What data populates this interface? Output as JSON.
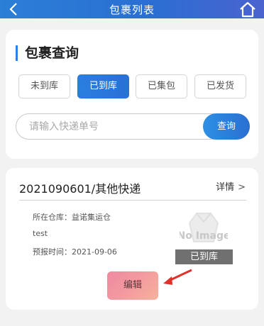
{
  "header": {
    "title": "包裹列表",
    "back_icon": "chevron-left-icon",
    "home_icon": "home-icon"
  },
  "query": {
    "title": "包裹查询",
    "accent_color": "#2e7fe0",
    "tabs": [
      {
        "label": "未到库",
        "active": false
      },
      {
        "label": "已到库",
        "active": true
      },
      {
        "label": "已集包",
        "active": false
      },
      {
        "label": "已发货",
        "active": false
      }
    ],
    "search": {
      "placeholder": "请输入快递单号",
      "value": "",
      "button_label": "查询"
    }
  },
  "package": {
    "number": "2021090601/其他快递",
    "detail_label": "详情",
    "warehouse": "所在仓库：益诺集运仓",
    "note": "test",
    "forecast_time": "预报时间：2021-09-06",
    "image_placeholder": "No Image",
    "status": "已到库",
    "edit_label": "编辑"
  }
}
